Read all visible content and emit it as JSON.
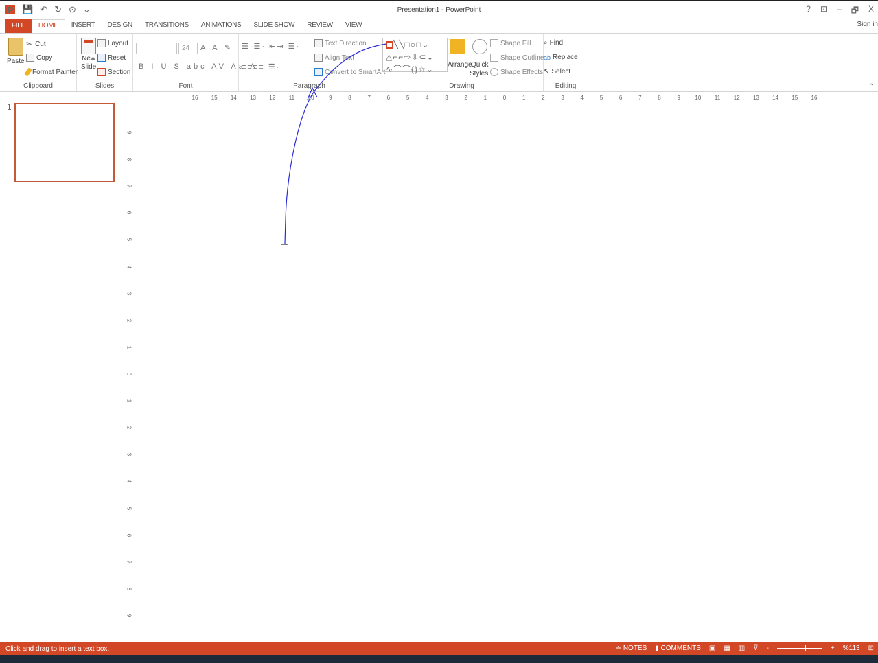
{
  "window": {
    "title": "Presentation1 - PowerPoint",
    "controls": [
      "?",
      "⊡",
      "–",
      "🗗",
      "X"
    ],
    "qat": [
      "💾",
      "↶",
      "↻",
      "⊙",
      "⌄"
    ]
  },
  "tabs": [
    "FILE",
    "HOME",
    "INSERT",
    "DESIGN",
    "TRANSITIONS",
    "ANIMATIONS",
    "SLIDE SHOW",
    "REVIEW",
    "VIEW"
  ],
  "active_tab": "HOME",
  "sign_in": "Sign in",
  "ribbon": {
    "clipboard": {
      "paste": "Paste",
      "cut": "Cut",
      "copy": "Copy",
      "format_painter": "Format Painter",
      "label": "Clipboard"
    },
    "slides": {
      "new_slide_1": "New",
      "new_slide_2": "Slide",
      "layout": "Layout",
      "reset": "Reset",
      "section": "Section",
      "label": "Slides"
    },
    "font": {
      "size": "24",
      "label": "Font",
      "format_buttons": "B I U S abc AV Aa A"
    },
    "paragraph": {
      "text_direction": "Text Direction",
      "align_text": "Align Text",
      "convert": "Convert to SmartArt",
      "label": "Paragraph"
    },
    "drawing": {
      "arrange": "Arrange",
      "quick_styles_1": "Quick",
      "quick_styles_2": "Styles",
      "shape_fill": "Shape Fill",
      "shape_outline": "Shape Outline",
      "shape_effects": "Shape Effects",
      "label": "Drawing"
    },
    "editing": {
      "find": "Find",
      "replace": "Replace",
      "select": "Select",
      "label": "Editing"
    }
  },
  "thumbnail": {
    "number": "1"
  },
  "hruler_labels": [
    "16",
    "15",
    "14",
    "13",
    "12",
    "11",
    "10",
    "9",
    "8",
    "7",
    "6",
    "5",
    "4",
    "3",
    "2",
    "1",
    "0",
    "1",
    "2",
    "3",
    "4",
    "5",
    "6",
    "7",
    "8",
    "9",
    "10",
    "11",
    "12",
    "13",
    "14",
    "15",
    "16"
  ],
  "vruler_labels": [
    "9",
    "8",
    "7",
    "6",
    "5",
    "4",
    "3",
    "2",
    "1",
    "0",
    "1",
    "2",
    "3",
    "4",
    "5",
    "6",
    "7",
    "8",
    "9"
  ],
  "status": {
    "message": "Click and drag to insert a text box.",
    "notes": "NOTES",
    "comments": "COMMENTS",
    "zoom": "%113"
  },
  "colors": {
    "accent": "#d24726",
    "annotation": "#2a2ad6"
  }
}
